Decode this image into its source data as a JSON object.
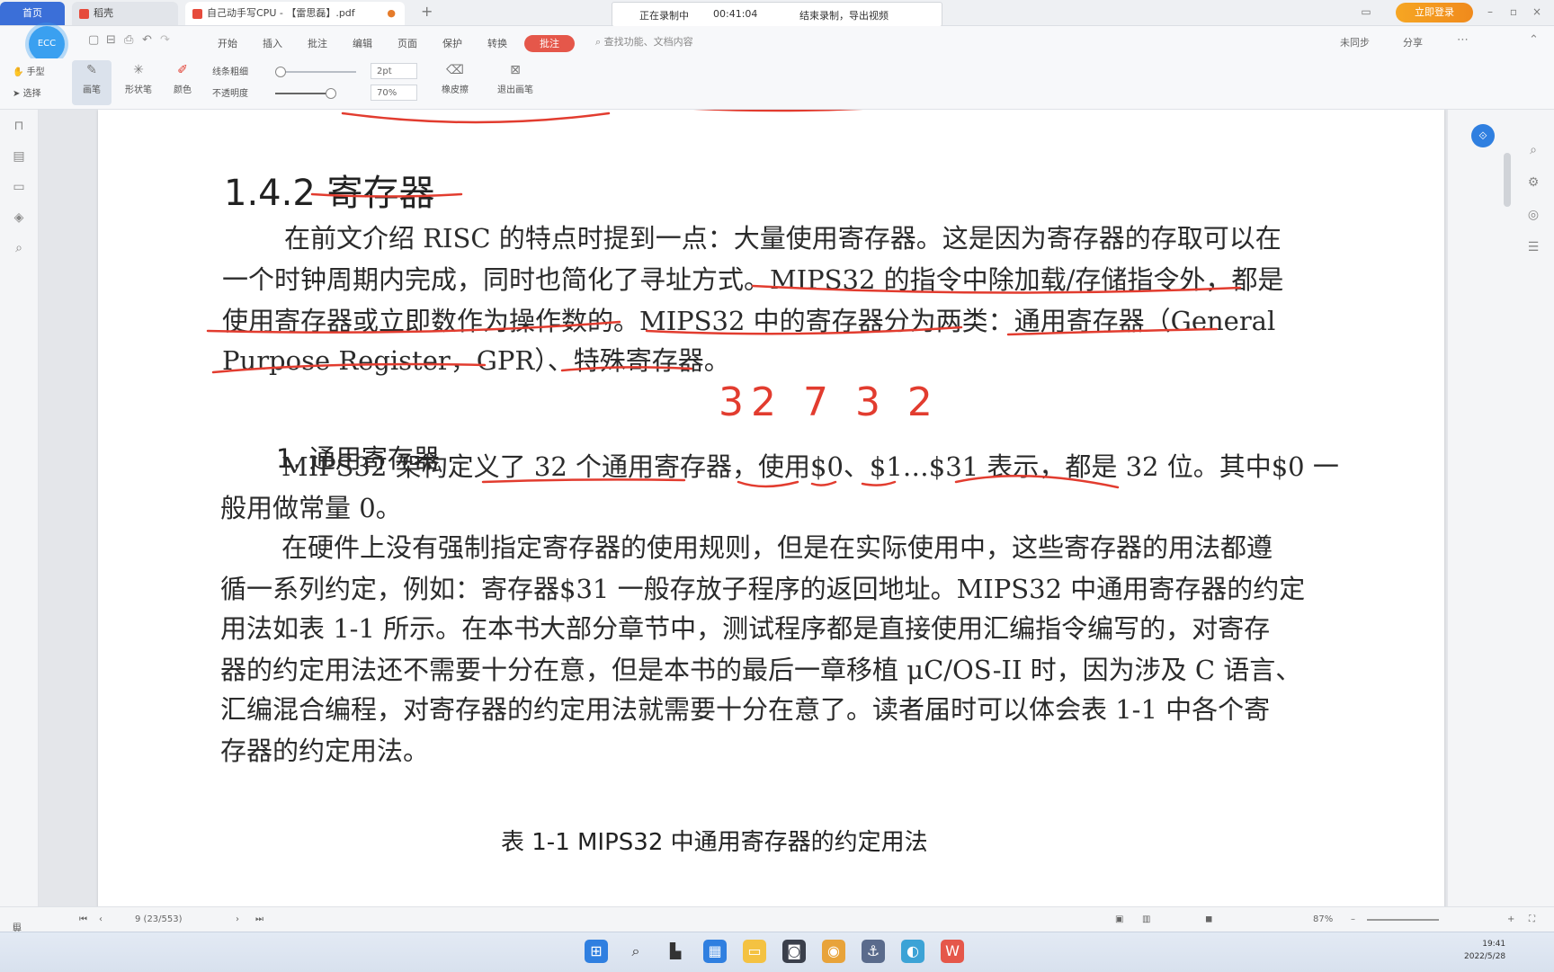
{
  "titlebar": {
    "tab_home": "首页",
    "tab_wps": "稻壳",
    "tab_pdf": "自己动手写CPU - 【雷思磊】.pdf",
    "rec_status": "正在录制中",
    "rec_time": "00:41:04",
    "rec_action": "结束录制，导出视频",
    "login_label": "立即登录"
  },
  "menubar": {
    "avatar_label": "ECC",
    "items": [
      "开始",
      "插入",
      "批注",
      "编辑",
      "页面",
      "保护",
      "转换"
    ],
    "active_tab": "批注",
    "search_placeholder": "查找功能、文档内容",
    "right_items": [
      "未同步",
      "分享"
    ]
  },
  "ribbon": {
    "hand": "手型",
    "select": "选择",
    "draw_pen": "画笔",
    "shape_pen": "形状笔",
    "color": "颜色",
    "smooth": "线条粗细",
    "opacity": "不透明度",
    "size_value": "2pt",
    "opacity_value": "70%",
    "eraser": "橡皮擦",
    "exit": "退出画笔"
  },
  "document": {
    "section_title": "1.4.2 寄存器",
    "para1_line1": "在前文介绍 RISC 的特点时提到一点：大量使用寄存器。这是因为寄存器的存取可以在",
    "para1_line2": "一个时钟周期内完成，同时也简化了寻址方式。MIPS32 的指令中除加载/存储指令外，都是",
    "para1_line3": "使用寄存器或立即数作为操作数的。MIPS32 中的寄存器分为两类：通用寄存器（General",
    "para1_line4": "Purpose Register，GPR）、特殊寄存器。",
    "subsection_title": "1. 通用寄存器",
    "para2_line1": "MIPS32 架构定义了 32 个通用寄存器，使用$0、$1…$31 表示，都是 32 位。其中$0 一",
    "para2_line2": "般用做常量 0。",
    "para3_line1": "在硬件上没有强制指定寄存器的使用规则，但是在实际使用中，这些寄存器的用法都遵",
    "para3_line2": "循一系列约定，例如：寄存器$31 一般存放子程序的返回地址。MIPS32 中通用寄存器的约定",
    "para3_line3": "用法如表 1-1 所示。在本书大部分章节中，测试程序都是直接使用汇编指令编写的，对寄存",
    "para3_line4": "器的约定用法还不需要十分在意，但是本书的最后一章移植 μC/OS-II 时，因为涉及 C 语言、",
    "para3_line5": "汇编混合编程，对寄存器的约定用法就需要十分在意了。读者届时可以体会表 1-1 中各个寄",
    "para3_line6": "存器的约定用法。",
    "table_caption": "表 1-1   MIPS32 中通用寄存器的约定用法",
    "handwriting": "32 7 3 2"
  },
  "statusbar": {
    "nav_label": "导航",
    "page_indicator": "9 (23/553)",
    "zoom_label": "87%"
  },
  "taskbar": {
    "time": "19:41",
    "date": "2022/5/28"
  },
  "colors": {
    "accent": "#3b6fd8",
    "annotation_red": "#e23c2f",
    "active_tab": "#e5574a"
  }
}
